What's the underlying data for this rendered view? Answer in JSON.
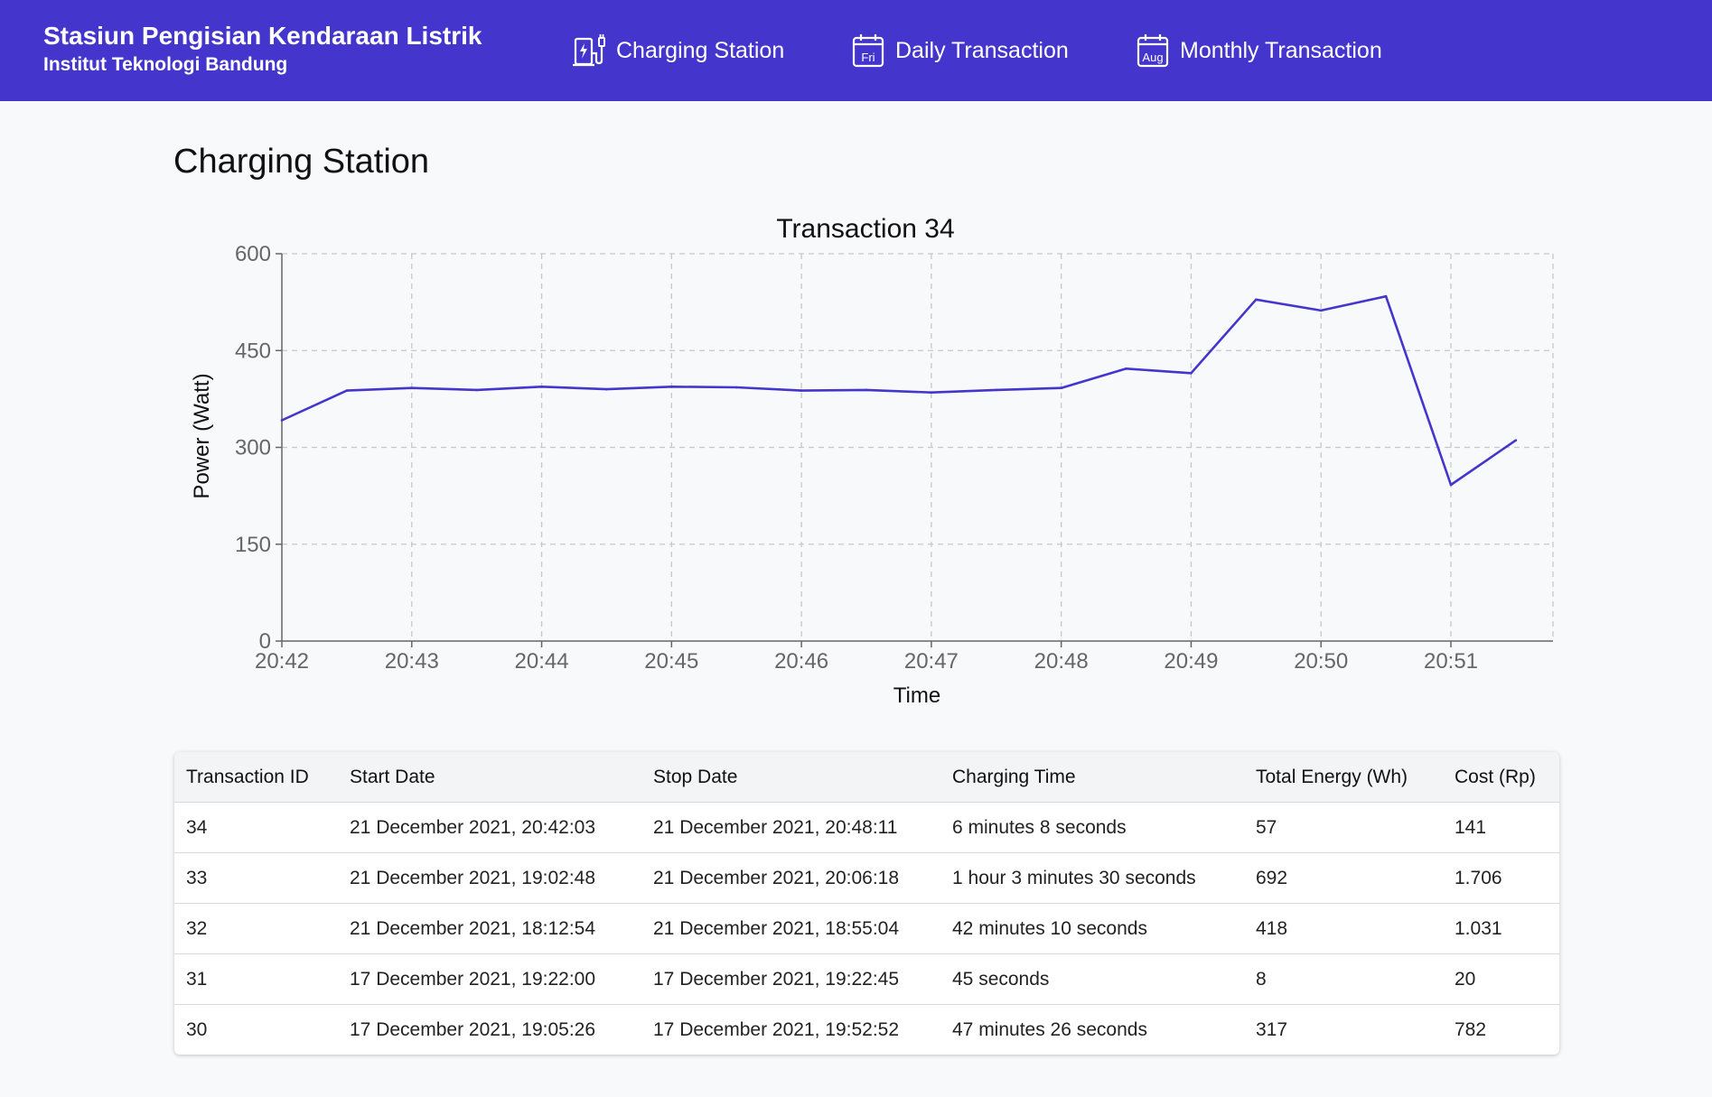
{
  "header": {
    "title": "Stasiun Pengisian Kendaraan Listrik",
    "subtitle": "Institut Teknologi Bandung",
    "nav": [
      {
        "label": "Charging Station",
        "icon": "ev-charger-icon"
      },
      {
        "label": "Daily Transaction",
        "icon": "calendar-day-icon",
        "icon_text": "Fri"
      },
      {
        "label": "Monthly Transaction",
        "icon": "calendar-month-icon",
        "icon_text": "Aug"
      }
    ],
    "background": "#4436cc"
  },
  "page": {
    "title": "Charging Station"
  },
  "chart_data": {
    "type": "line",
    "title": "Transaction 34",
    "xlabel": "Time",
    "ylabel": "Power (Watt)",
    "x_ticks": [
      "20:42",
      "20:43",
      "20:44",
      "20:45",
      "20:46",
      "20:47",
      "20:48",
      "20:49",
      "20:50",
      "20:51"
    ],
    "y_ticks": [
      0,
      150,
      300,
      450,
      600
    ],
    "ylim": [
      0,
      600
    ],
    "grid": true,
    "color": "#4436cc",
    "x": [
      "20:42:00",
      "20:42:30",
      "20:43:00",
      "20:43:30",
      "20:44:00",
      "20:44:30",
      "20:45:00",
      "20:45:30",
      "20:46:00",
      "20:46:30",
      "20:47:00",
      "20:47:30",
      "20:48:00",
      "20:48:30",
      "20:49:00",
      "20:49:30",
      "20:50:00",
      "20:50:30",
      "20:51:00",
      "20:51:30"
    ],
    "values": [
      342,
      388,
      392,
      389,
      394,
      390,
      394,
      393,
      388,
      389,
      385,
      389,
      392,
      422,
      415,
      529,
      512,
      534,
      242,
      311
    ]
  },
  "table": {
    "columns": [
      "Transaction ID",
      "Start Date",
      "Stop Date",
      "Charging Time",
      "Total Energy (Wh)",
      "Cost (Rp)"
    ],
    "rows": [
      [
        "34",
        "21 December 2021, 20:42:03",
        "21 December 2021, 20:48:11",
        "6 minutes 8 seconds",
        "57",
        "141"
      ],
      [
        "33",
        "21 December 2021, 19:02:48",
        "21 December 2021, 20:06:18",
        "1 hour 3 minutes 30 seconds",
        "692",
        "1.706"
      ],
      [
        "32",
        "21 December 2021, 18:12:54",
        "21 December 2021, 18:55:04",
        "42 minutes 10 seconds",
        "418",
        "1.031"
      ],
      [
        "31",
        "17 December 2021, 19:22:00",
        "17 December 2021, 19:22:45",
        "45 seconds",
        "8",
        "20"
      ],
      [
        "30",
        "17 December 2021, 19:05:26",
        "17 December 2021, 19:52:52",
        "47 minutes 26 seconds",
        "317",
        "782"
      ]
    ]
  }
}
